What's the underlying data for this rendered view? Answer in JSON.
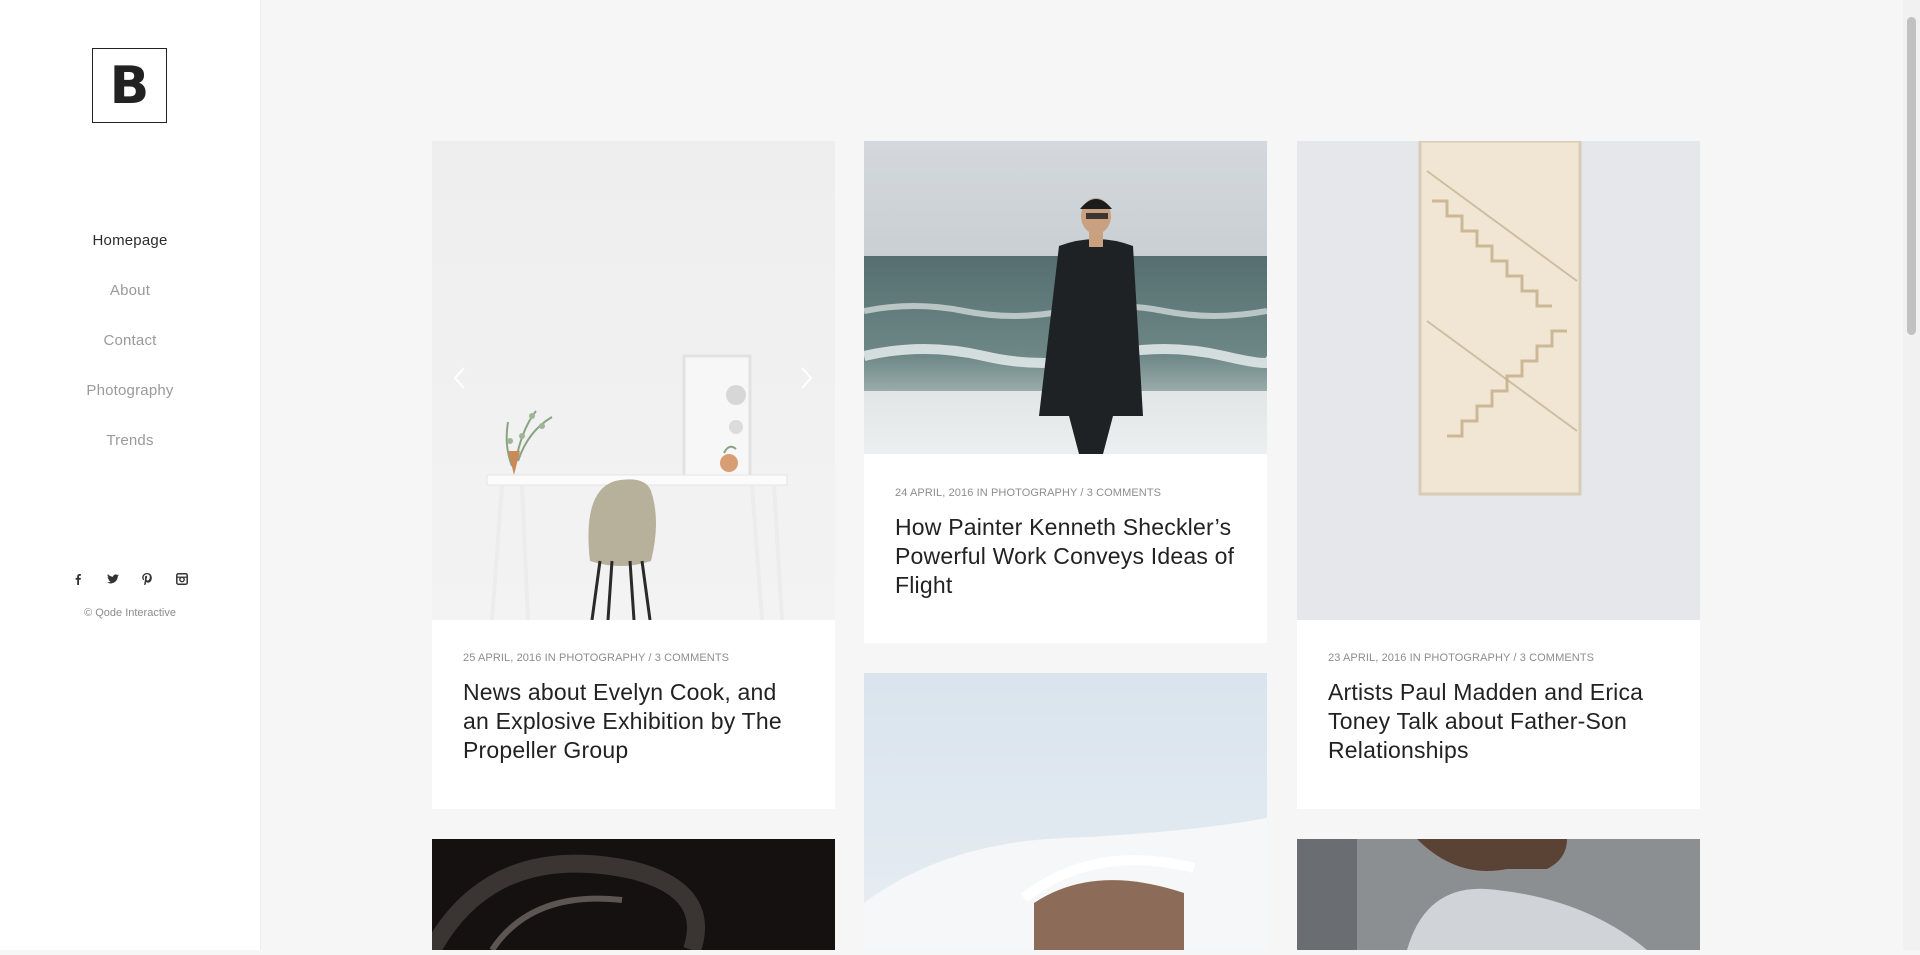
{
  "logo": {
    "letter": "B"
  },
  "nav": {
    "items": [
      {
        "label": "Homepage",
        "active": true
      },
      {
        "label": "About"
      },
      {
        "label": "Contact"
      },
      {
        "label": "Photography"
      },
      {
        "label": "Trends"
      }
    ]
  },
  "social": {
    "icons": [
      "facebook-icon",
      "twitter-icon",
      "pinterest-icon",
      "instagram-icon"
    ]
  },
  "footer": {
    "copyright": "© Qode Interactive"
  },
  "posts": [
    {
      "date": "25 APRIL, 2016",
      "in_word": "IN",
      "category": "PHOTOGRAPHY",
      "separator": "/",
      "comments": "3 COMMENTS",
      "title": "News about Evelyn Cook, and an Explosive Exhibition by The Propeller Group"
    },
    {
      "date": "24 APRIL, 2016",
      "in_word": "IN",
      "category": "PHOTOGRAPHY",
      "separator": "/",
      "comments": "3 COMMENTS",
      "title": "How Painter Kenneth Sheckler’s Powerful Work Conveys Ideas of Flight"
    },
    {
      "date": "23 APRIL, 2016",
      "in_word": "IN",
      "category": "PHOTOGRAPHY",
      "separator": "/",
      "comments": "3 COMMENTS",
      "title": "Artists Paul Madden and Erica Toney Talk about Father-Son Relationships"
    }
  ],
  "colors": {
    "background": "#f6f6f6",
    "sidebar": "#ffffff",
    "text": "#222222",
    "muted": "#9a9a9a"
  }
}
